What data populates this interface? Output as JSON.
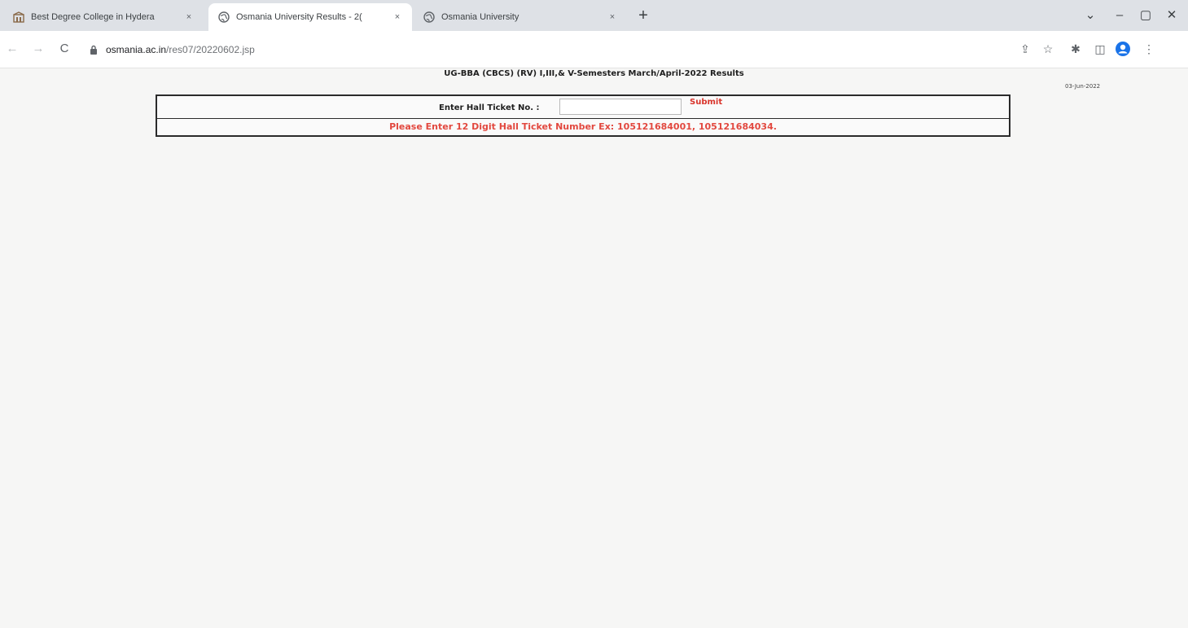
{
  "browser": {
    "tabs": [
      {
        "title": "Best Degree College in Hydera",
        "active": false,
        "favicon": "college-crest-icon"
      },
      {
        "title": "Osmania University Results - 2(",
        "active": true,
        "favicon": "globe-icon"
      },
      {
        "title": "Osmania University",
        "active": false,
        "favicon": "globe-icon"
      }
    ],
    "close_glyph": "×",
    "new_tab_glyph": "+",
    "window_controls": {
      "tab_search": "⌄",
      "minimize": "–",
      "restore": "▢",
      "close": "✕"
    },
    "nav": {
      "back": "←",
      "forward": "→",
      "reload": "C"
    },
    "address": {
      "domain": "osmania.ac.in",
      "path": "/res07/20220602.jsp"
    },
    "toolbar_icons": {
      "share": "⇪",
      "bookmark": "☆",
      "extensions": "✱",
      "side_panel": "◫",
      "menu": "⋮"
    }
  },
  "page": {
    "heading": "UG-BBA (CBCS) (RV) I,III,& V-Semesters March/April-2022 Results",
    "date": "03-Jun-2022",
    "form": {
      "label": "Enter Hall Ticket No. :",
      "input_value": "",
      "input_placeholder": "",
      "submit_label": "Submit",
      "hint": "Please Enter 12 Digit Hall Ticket Number Ex: 105121684001, 105121684034."
    }
  },
  "colors": {
    "accent_red": "#e2483f",
    "submit_red": "#d9342b",
    "page_bg": "#f6f6f5",
    "tabstrip_bg": "#dee1e6"
  }
}
